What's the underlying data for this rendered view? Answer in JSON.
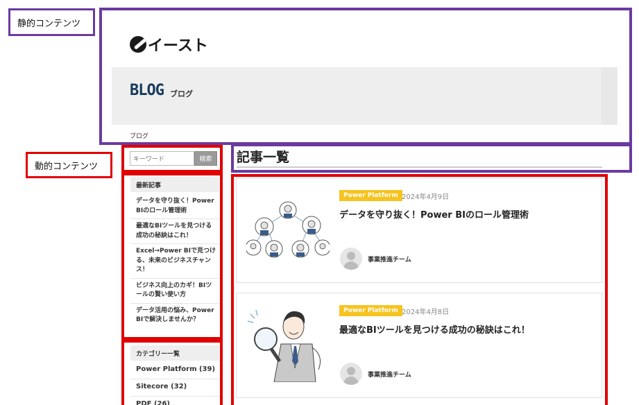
{
  "annotations": {
    "static_label": "静的コンテンツ",
    "dynamic_label": "動的コンテンツ",
    "static_color": "#6a3aa0",
    "dynamic_color": "#e00000"
  },
  "header": {
    "logo_text": "イースト",
    "hero_title": "BLOG",
    "hero_subtitle": "ブログ",
    "breadcrumb": "ブログ"
  },
  "search": {
    "placeholder": "キーワード",
    "button_label": "検索"
  },
  "sidebar": {
    "recent_heading": "最新記事",
    "recent_items": [
      "データを守り抜く！Power BIのロール管理術",
      "最適なBIツールを見つける成功の秘訣はこれ！",
      "Excel→Power BIで見つける、未来のビジネスチャンス！",
      "ビジネス向上のカギ！BIツールの賢い使い方",
      "データ活用の悩み、Power BIで解決しませんか？"
    ],
    "category_heading": "カテゴリー一覧",
    "categories": [
      "Power Platform (39)",
      "Sitecore (32)",
      "PDF (26)"
    ]
  },
  "main": {
    "list_title": "記事一覧",
    "articles": [
      {
        "tag": "Power Platform",
        "date": "2024年4月9日",
        "title": "データを守り抜く！Power BIのロール管理術",
        "author": "事業推進チーム"
      },
      {
        "tag": "Power Platform",
        "date": "2024年4月8日",
        "title": "最適なBIツールを見つける成功の秘訣はこれ！",
        "author": "事業推進チーム"
      }
    ]
  },
  "colors": {
    "tag": "#f7c31f",
    "hero_title": "#163a5c"
  }
}
